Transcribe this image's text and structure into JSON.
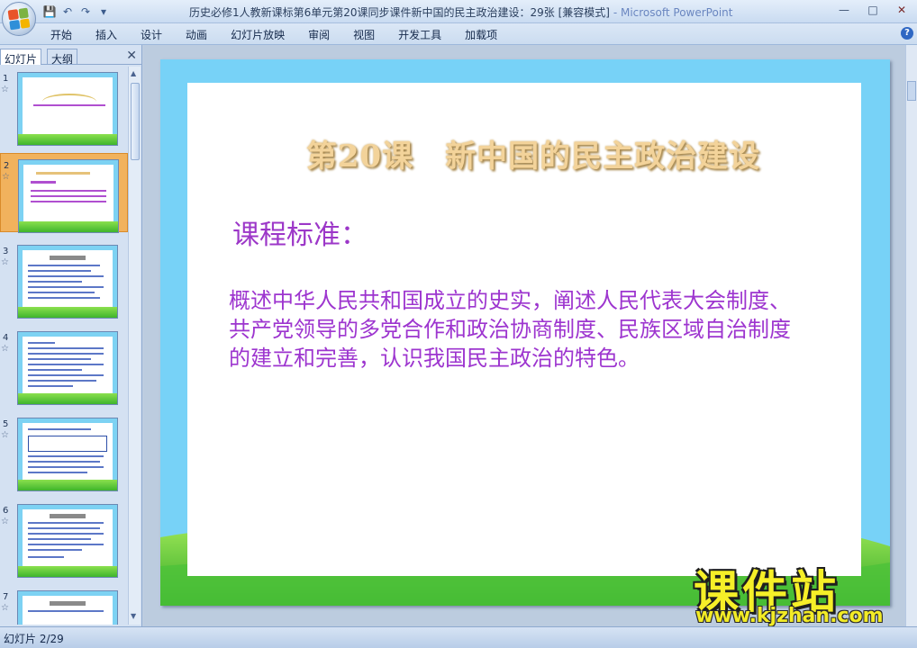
{
  "window": {
    "title": "历史必修1人教新课标第6单元第20课同步课件新中国的民主政治建设：29张 [兼容模式]",
    "app_name": "- Microsoft PowerPoint",
    "buttons": {
      "minimize": "—",
      "restore": "□",
      "close": "✕"
    }
  },
  "quick_access": {
    "save": "💾",
    "undo": "↶",
    "redo": "↷",
    "more": "▾"
  },
  "ribbon": {
    "tabs": [
      "开始",
      "插入",
      "设计",
      "动画",
      "幻灯片放映",
      "审阅",
      "视图",
      "开发工具",
      "加载项"
    ],
    "help": "?"
  },
  "left_pane": {
    "tabs": [
      "幻灯片",
      "大纲"
    ],
    "close": "✕",
    "thumbnails": [
      {
        "num": "1",
        "star": "☆"
      },
      {
        "num": "2",
        "star": "☆"
      },
      {
        "num": "3",
        "star": "☆"
      },
      {
        "num": "4",
        "star": "☆"
      },
      {
        "num": "5",
        "star": "☆"
      },
      {
        "num": "6",
        "star": "☆"
      },
      {
        "num": "7",
        "star": "☆"
      }
    ],
    "selected_index": 2
  },
  "slide": {
    "title": "第20课　新中国的民主政治建设",
    "heading": "课程标准：",
    "body": "概述中华人民共和国成立的史实，阐述人民代表大会制度、共产党领导的多党合作和政治协商制度、民族区域自治制度的建立和完善，认识我国民主政治的特色。",
    "colors": {
      "frame": "#77d2f7",
      "title": "#f3d39a",
      "text": "#9d35cf",
      "grass": "#3fb52c"
    }
  },
  "watermark": {
    "title": "课件站",
    "url": "www.kjzhan.com"
  },
  "status": {
    "slide_info": "幻灯片 2/29"
  }
}
